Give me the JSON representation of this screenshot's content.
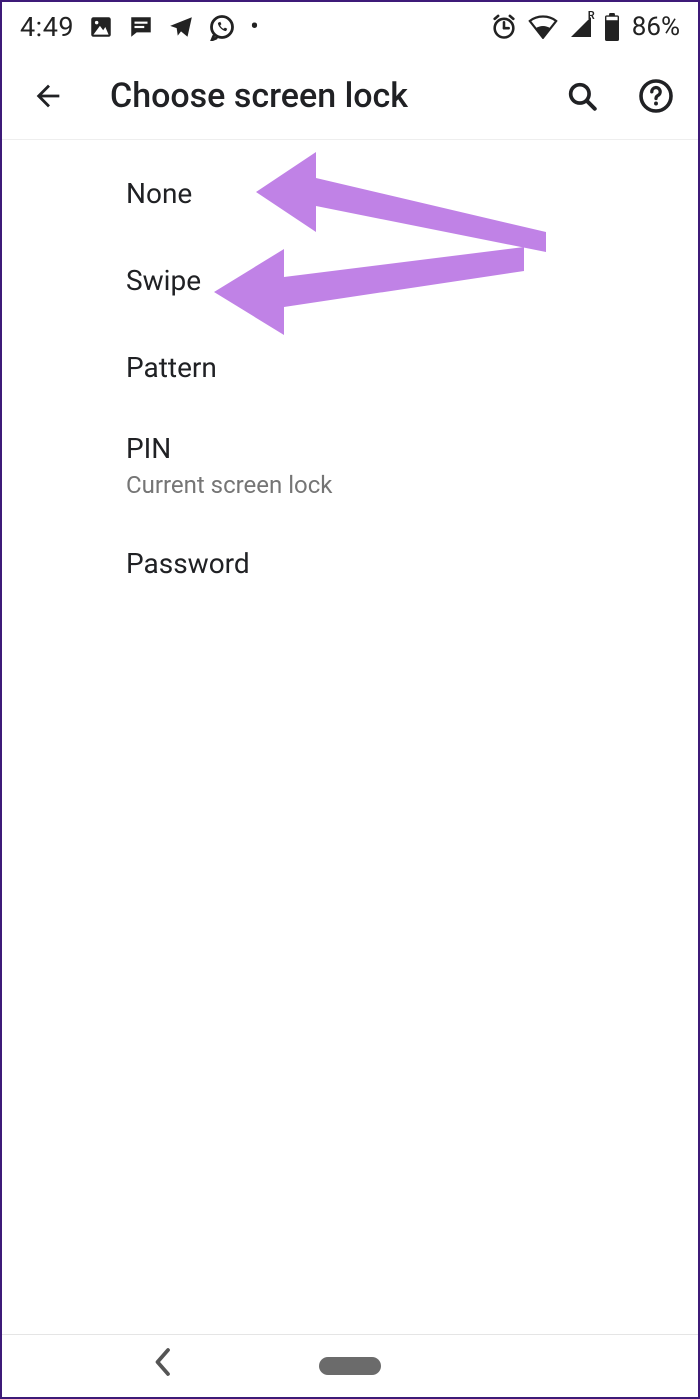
{
  "status_bar": {
    "time": "4:49",
    "battery": "86%",
    "roaming_letter": "R"
  },
  "app_bar": {
    "title": "Choose screen lock"
  },
  "options": {
    "none": {
      "label": "None"
    },
    "swipe": {
      "label": "Swipe"
    },
    "pattern": {
      "label": "Pattern"
    },
    "pin": {
      "label": "PIN",
      "subtitle": "Current screen lock"
    },
    "password": {
      "label": "Password"
    }
  },
  "annotation_color": "#c082e6"
}
